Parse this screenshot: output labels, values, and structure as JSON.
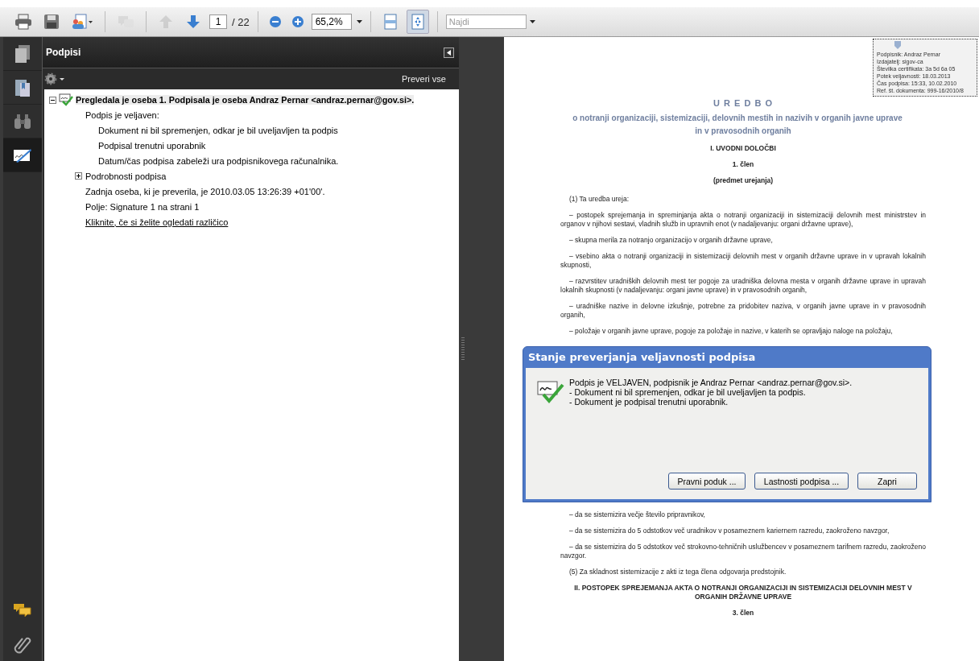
{
  "toolbar": {
    "buttons": [
      {
        "kind": "print",
        "disabled": false
      },
      {
        "kind": "save",
        "disabled": false
      },
      {
        "kind": "share",
        "disabled": false
      },
      {
        "kind": "comment",
        "disabled": true
      },
      {
        "kind": "prev-page",
        "disabled": true
      },
      {
        "kind": "next-page",
        "disabled": false
      }
    ],
    "page_number": "1",
    "page_count": "/ 22",
    "zoom_buttons": [
      {
        "kind": "zoom-out"
      },
      {
        "kind": "zoom-in"
      }
    ],
    "zoom": "65,2%",
    "view_modes": [
      {
        "kind": "fit-width",
        "selected": false
      },
      {
        "kind": "fit-page",
        "selected": true
      }
    ],
    "search": {
      "placeholder": "Najdi"
    }
  },
  "nav": {
    "items": [
      {
        "kind": "pages",
        "selected": false
      },
      {
        "kind": "bookmarks",
        "selected": false
      },
      {
        "kind": "find",
        "selected": false
      },
      {
        "kind": "signatures",
        "selected": true
      }
    ],
    "bottom_items": [
      {
        "kind": "comments"
      },
      {
        "kind": "attachments"
      }
    ]
  },
  "panel": {
    "title": "Podpisi",
    "verify_all": "Preveri vse",
    "signatures": [
      {
        "title": "Pregledala je oseba 1. Podpisala je oseba Andraz Pernar <andraz.pernar@gov.si>.",
        "expanded": true,
        "children": [
          {
            "kind": "text",
            "text": "Podpis je veljaven:",
            "children": [
              {
                "kind": "text",
                "text": "Dokument ni bil spremenjen, odkar je bil uveljavljen ta podpis"
              },
              {
                "kind": "text",
                "text": "Podpisal trenutni uporabnik"
              },
              {
                "kind": "text",
                "text": "Datum/čas podpisa zabeleži ura podpisnikovega računalnika."
              }
            ]
          },
          {
            "kind": "group",
            "text": "Podrobnosti podpisa",
            "expanded": false
          },
          {
            "kind": "text",
            "text": "Zadnja oseba, ki je preverila, je 2010.03.05 13:26:39 +01'00'."
          },
          {
            "kind": "text",
            "text": "Polje: Signature 1 na strani 1"
          },
          {
            "kind": "link",
            "text": "Kliknite, če si želite ogledati različico"
          }
        ]
      }
    ]
  },
  "document": {
    "stamp": [
      "Podpisnik: Andraz Pernar",
      "Izdajatelj: sigov-ca",
      "Številka certifikata: 3a 5d 6a 05",
      "Potek veljavnosti: 18.03.2013",
      "Čas podpisa: 15:33, 10.02.2010",
      "Ref. št. dokumenta: 999-16/2010/8"
    ],
    "blocks": [
      {
        "kind": "title",
        "text": "U R E D B O"
      },
      {
        "kind": "subtitle",
        "text": "o notranji organizaciji, sistemizaciji, delovnih mestih in nazivih v organih javne uprave"
      },
      {
        "kind": "subtitle",
        "text": "in v pravosodnih organih"
      },
      {
        "kind": "heading",
        "text": "I. UVODNI DOLOČBI"
      },
      {
        "kind": "heading",
        "text": "1. člen"
      },
      {
        "kind": "heading",
        "text": "(predmet urejanja)"
      },
      {
        "kind": "paragraph",
        "text": "(1) Ta uredba ureja:"
      },
      {
        "kind": "paragraph",
        "text": "– postopek sprejemanja in spreminjanja akta o notranji organizaciji in sistemizaciji delovnih mest ministrstev in organov v njihovi sestavi, vladnih služb in upravnih enot (v nadaljevanju: organi državne uprave),"
      },
      {
        "kind": "paragraph",
        "text": "– skupna merila za notranjo organizacijo v organih državne uprave,"
      },
      {
        "kind": "paragraph",
        "text": "– vsebino akta o notranji organizaciji in sistemizaciji delovnih mest v organih državne uprave in v upravah lokalnih skupnosti,"
      },
      {
        "kind": "paragraph",
        "text": "– razvrstitev uradniških delovnih mest ter pogoje za uradniška delovna mesta v organih državne uprave in upravah lokalnih skupnosti (v nadaljevanju: organi javne uprave) in v pravosodnih organih,"
      },
      {
        "kind": "paragraph",
        "text": "– uradniške nazive in delovne izkušnje, potrebne za pridobitev naziva, v organih javne uprave in v pravosodnih organih,"
      },
      {
        "kind": "paragraph",
        "text": "– položaje v organih javne uprave, pogoje za položaje in nazive, v katerih se opravljajo naloge na položaju,"
      }
    ],
    "blocks_below": [
      {
        "kind": "paragraph",
        "text": "– da se sistemizira večje število pripravnikov,"
      },
      {
        "kind": "paragraph",
        "text": "– da se sistemizira do 5 odstotkov več uradnikov v posameznem kariernem razredu, zaokroženo navzgor,"
      },
      {
        "kind": "paragraph",
        "text": "– da se sistemizira do 5 odstotkov več strokovno-tehničnih uslužbencev v posameznem tarifnem razredu, zaokroženo navzgor."
      },
      {
        "kind": "paragraph",
        "text": "(5) Za skladnost sistemizacije z akti iz tega člena odgovarja predstojnik."
      },
      {
        "kind": "heading",
        "text": "II. POSTOPEK SPREJEMANJA AKTA O NOTRANJI ORGANIZACIJI IN SISTEMIZACIJI DELOVNIH MEST V ORGANIH DRŽAVNE UPRAVE"
      },
      {
        "kind": "heading",
        "text": "3. člen"
      }
    ]
  },
  "dialog": {
    "title": "Stanje preverjanja veljavnosti podpisa",
    "message": [
      "Podpis je VELJAVEN, podpisnik je Andraz Pernar <andraz.pernar@gov.si>.",
      "- Dokument ni bil spremenjen, odkar je bil uveljavljen ta podpis.",
      "- Dokument je podpisal trenutni uporabnik."
    ],
    "buttons": [
      "Pravni poduk ...",
      "Lastnosti podpisa ...",
      "Zapri"
    ]
  }
}
